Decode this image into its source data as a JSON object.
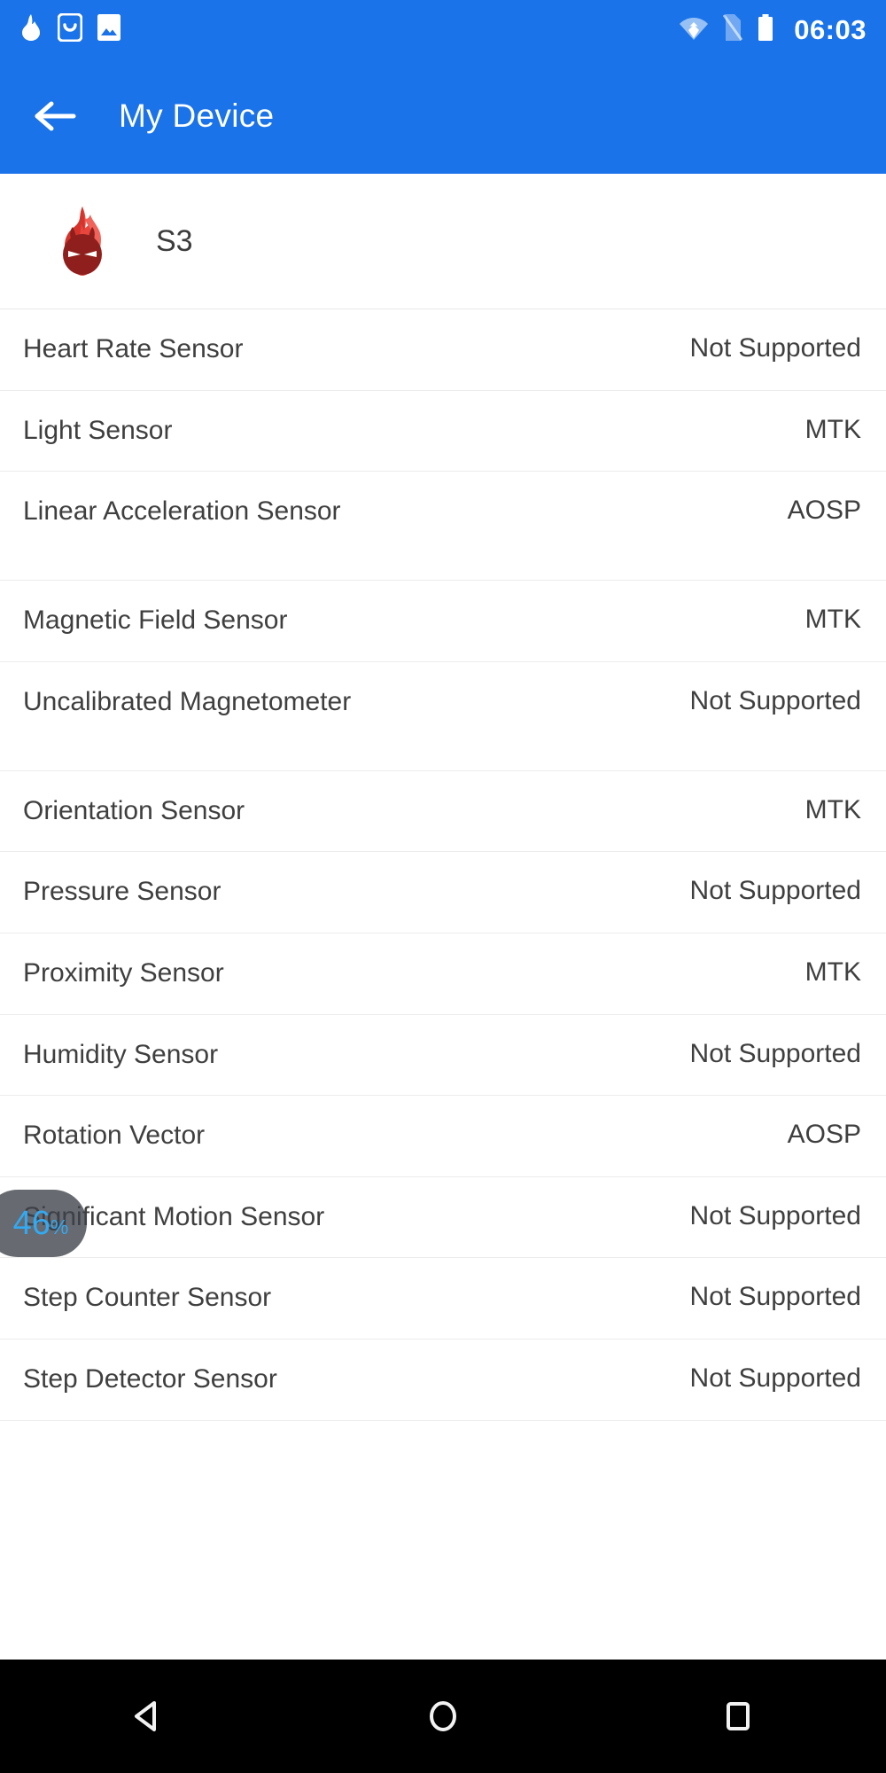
{
  "status_bar": {
    "icons": [
      {
        "name": "flame-notification-icon",
        "label": "AnTuTu"
      },
      {
        "name": "smiley-app-notification-icon",
        "label": "App"
      },
      {
        "name": "image-notification-icon",
        "label": "Screenshot"
      }
    ],
    "wifi": "wifi-icon",
    "sim": "no-sim-icon",
    "battery": "battery-icon",
    "time": "06:03"
  },
  "app_bar": {
    "back": "back-arrow-icon",
    "title": "My Device",
    "background_color": "#1a73e8",
    "text_color": "#ffffff"
  },
  "device": {
    "icon": "antutu-flame-icon",
    "name": "S3"
  },
  "overlay": {
    "value": "46",
    "unit": "%",
    "accent_color": "#33a9f2",
    "background_color": "rgba(60,64,72,0.78)"
  },
  "nav_bar": {
    "back": "nav-back-triangle-icon",
    "home": "nav-home-circle-icon",
    "recents": "nav-recents-square-icon"
  },
  "sensors": [
    {
      "label": "Heart Rate Sensor",
      "value": "Not Supported",
      "two_line": false
    },
    {
      "label": "Light Sensor",
      "value": "MTK",
      "two_line": false
    },
    {
      "label": "Linear Acceleration Sensor",
      "value": "AOSP",
      "two_line": true
    },
    {
      "label": "Magnetic Field Sensor",
      "value": "MTK",
      "two_line": false
    },
    {
      "label": "Uncalibrated Magnetometer",
      "value": "Not Supported",
      "two_line": true
    },
    {
      "label": "Orientation Sensor",
      "value": "MTK",
      "two_line": false
    },
    {
      "label": "Pressure Sensor",
      "value": "Not Supported",
      "two_line": false
    },
    {
      "label": "Proximity Sensor",
      "value": "MTK",
      "two_line": false
    },
    {
      "label": "Humidity Sensor",
      "value": "Not Supported",
      "two_line": false
    },
    {
      "label": "Rotation Vector",
      "value": "AOSP",
      "two_line": false
    },
    {
      "label": "Significant Motion Sensor",
      "value": "Not Supported",
      "two_line": false
    },
    {
      "label": "Step Counter Sensor",
      "value": "Not Supported",
      "two_line": false
    },
    {
      "label": "Step Detector Sensor",
      "value": "Not Supported",
      "two_line": false
    }
  ]
}
